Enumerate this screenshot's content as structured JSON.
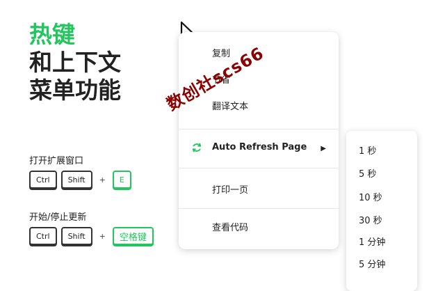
{
  "hero": {
    "line1": "热键",
    "line2": "和上下文",
    "line3": "菜单功能"
  },
  "shortcuts": [
    {
      "title": "打开扩展窗口",
      "keys": [
        "Ctrl",
        "Shift"
      ],
      "plus": "+",
      "action_key": "E"
    },
    {
      "title": "开始/停止更新",
      "keys": [
        "Ctrl",
        "Shift"
      ],
      "plus": "+",
      "action_key": "空格键"
    }
  ],
  "context_menu": {
    "copy": "复制",
    "save": "节省",
    "translate": "翻译文本",
    "auto_refresh": "Auto Refresh Page",
    "print": "打印一页",
    "view_source": "查看代码"
  },
  "submenu": [
    "1 秒",
    "5 秒",
    "10 秒",
    "30 秒",
    "1 分钟",
    "5 分钟"
  ],
  "watermark": "数创社scs66",
  "colors": {
    "accent": "#22c55e",
    "watermark": "#8b0000"
  }
}
